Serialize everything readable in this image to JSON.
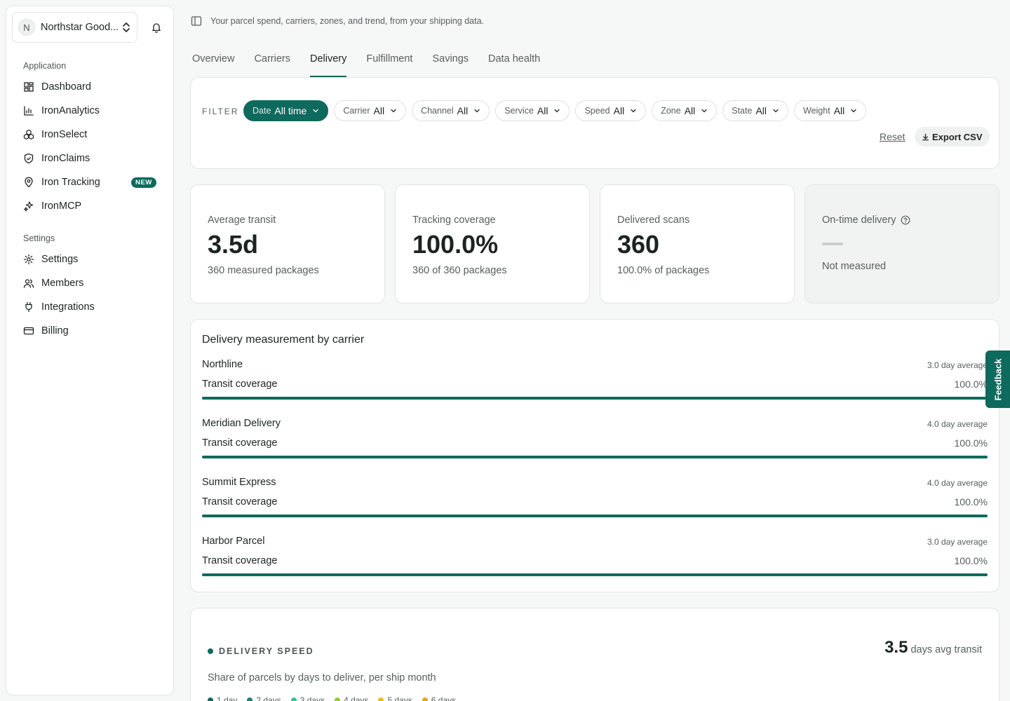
{
  "org": {
    "initial": "N",
    "name": "Northstar Good..."
  },
  "nav": {
    "application_label": "Application",
    "application_items": [
      {
        "label": "Dashboard",
        "icon": "dashboard-icon"
      },
      {
        "label": "IronAnalytics",
        "icon": "bar-chart-icon"
      },
      {
        "label": "IronSelect",
        "icon": "boxes-icon"
      },
      {
        "label": "IronClaims",
        "icon": "shield-check-icon"
      },
      {
        "label": "Iron Tracking",
        "icon": "map-pin-icon",
        "badge": "NEW"
      },
      {
        "label": "IronMCP",
        "icon": "sparkles-icon"
      }
    ],
    "settings_label": "Settings",
    "settings_items": [
      {
        "label": "Settings",
        "icon": "gear-icon"
      },
      {
        "label": "Members",
        "icon": "users-icon"
      },
      {
        "label": "Integrations",
        "icon": "plug-icon"
      },
      {
        "label": "Billing",
        "icon": "credit-card-icon"
      }
    ]
  },
  "header": {
    "subtitle": "Your parcel spend, carriers, zones, and trend, from your shipping data."
  },
  "tabs": [
    "Overview",
    "Carriers",
    "Delivery",
    "Fulfillment",
    "Savings",
    "Data health"
  ],
  "active_tab": "Delivery",
  "filter": {
    "label": "FILTER",
    "chips": [
      {
        "key": "Date",
        "value": "All time",
        "active": true
      },
      {
        "key": "Carrier",
        "value": "All"
      },
      {
        "key": "Channel",
        "value": "All"
      },
      {
        "key": "Service",
        "value": "All"
      },
      {
        "key": "Speed",
        "value": "All"
      },
      {
        "key": "Zone",
        "value": "All"
      },
      {
        "key": "State",
        "value": "All"
      },
      {
        "key": "Weight",
        "value": "All"
      }
    ],
    "reset_label": "Reset",
    "export_label": "Export CSV"
  },
  "stats": [
    {
      "label": "Average transit",
      "value": "3.5d",
      "sub": "360 measured packages"
    },
    {
      "label": "Tracking coverage",
      "value": "100.0%",
      "sub": "360 of 360 packages"
    },
    {
      "label": "Delivered scans",
      "value": "360",
      "sub": "100.0% of packages"
    },
    {
      "label": "On-time delivery",
      "value": "",
      "sub": "Not measured",
      "muted": true,
      "help_icon": "help-circle-icon"
    }
  ],
  "carriers": {
    "title": "Delivery measurement by carrier",
    "coverage_label": "Transit coverage",
    "items": [
      {
        "name": "Northline",
        "avg": "3.0 day average",
        "coverage": "100.0%",
        "fill": 1.0
      },
      {
        "name": "Meridian Delivery",
        "avg": "4.0 day average",
        "coverage": "100.0%",
        "fill": 1.0
      },
      {
        "name": "Summit Express",
        "avg": "4.0 day average",
        "coverage": "100.0%",
        "fill": 1.0
      },
      {
        "name": "Harbor Parcel",
        "avg": "3.0 day average",
        "coverage": "100.0%",
        "fill": 1.0
      }
    ]
  },
  "speed": {
    "title": "DELIVERY SPEED",
    "avg_value": "3.5",
    "avg_label": "days avg transit",
    "description": "Share of parcels by days to deliver, per ship month",
    "legend": [
      {
        "label": "1 day",
        "color": "#0e6a5c"
      },
      {
        "label": "2 days",
        "color": "#13876f"
      },
      {
        "label": "3 days",
        "color": "#2cc79a"
      },
      {
        "label": "4 days",
        "color": "#8fcf2a"
      },
      {
        "label": "5 days",
        "color": "#f2b90c"
      },
      {
        "label": "6 days",
        "color": "#f59e0b"
      }
    ]
  },
  "feedback_label": "Feedback",
  "colors": {
    "accent": "#0e6a5c"
  }
}
